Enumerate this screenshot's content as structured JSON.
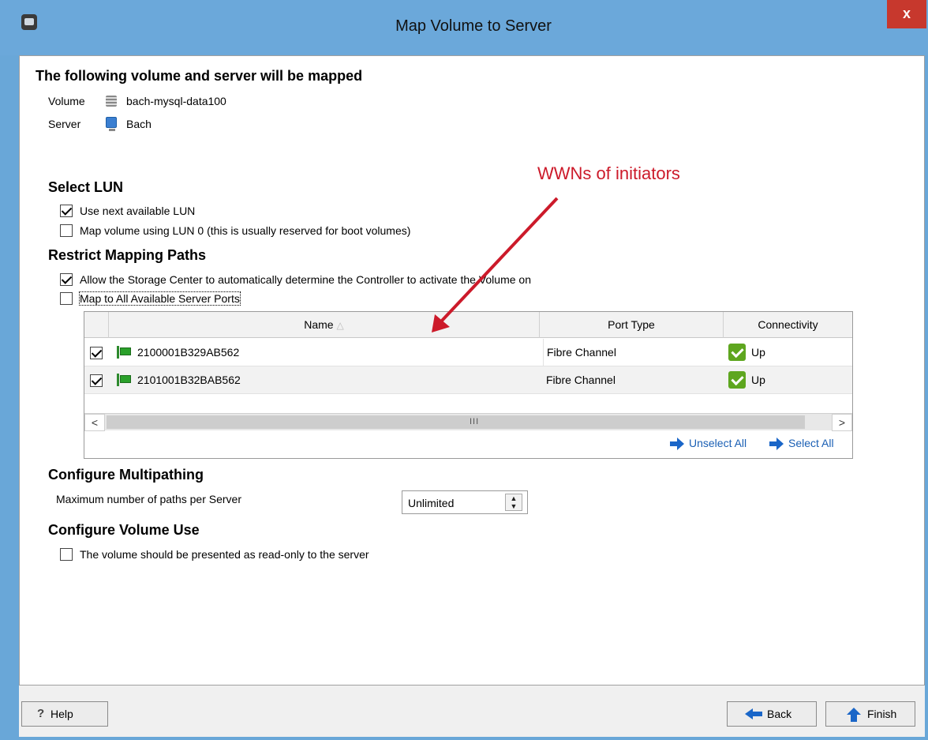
{
  "window": {
    "title": "Map Volume to Server",
    "close_label": "x"
  },
  "summary": {
    "heading": "The following volume and server will be mapped",
    "volume_label": "Volume",
    "volume_value": "bach-mysql-data100",
    "server_label": "Server",
    "server_value": "Bach"
  },
  "annotation": {
    "text": "WWNs of initiators",
    "color": "#cc1a2a"
  },
  "select_lun": {
    "heading": "Select LUN",
    "options": [
      {
        "label": "Use next available LUN",
        "checked": true
      },
      {
        "label": "Map volume using LUN 0 (this is usually reserved for boot volumes)",
        "checked": false
      }
    ]
  },
  "restrict_paths": {
    "heading": "Restrict Mapping Paths",
    "options": [
      {
        "label": "Allow the Storage Center to automatically determine the Controller to activate the Volume on",
        "checked": true
      },
      {
        "label": "Map to All Available Server Ports",
        "checked": false
      }
    ]
  },
  "ports_table": {
    "columns": {
      "name": "Name",
      "sort_indicator": "△",
      "port_type": "Port Type",
      "connectivity": "Connectivity"
    },
    "rows": [
      {
        "checked": true,
        "name": "2100001B329AB562",
        "port_type": "Fibre Channel",
        "connectivity": "Up",
        "icon": "fc-port-icon"
      },
      {
        "checked": true,
        "name": "2101001B32BAB562",
        "port_type": "Fibre Channel",
        "connectivity": "Up",
        "icon": "fc-port-icon"
      }
    ],
    "scroll_left": "<",
    "scroll_right": ">",
    "scroll_grip": "III",
    "unselect_all": "Unselect All",
    "select_all": "Select All"
  },
  "multipathing": {
    "heading": "Configure Multipathing",
    "max_paths_label": "Maximum number of paths per Server",
    "max_paths_value": "Unlimited"
  },
  "volume_use": {
    "heading": "Configure Volume Use",
    "options": [
      {
        "label": "The volume should be presented as read-only to the server",
        "checked": false
      }
    ]
  },
  "footer": {
    "help": "Help",
    "help_glyph": "?",
    "back": "Back",
    "finish": "Finish"
  },
  "colors": {
    "titlebar": "#6ba8da",
    "close": "#c7382d",
    "link": "#1a5fb4",
    "status_up": "#5ea61f"
  }
}
